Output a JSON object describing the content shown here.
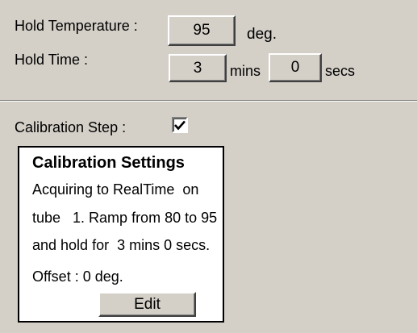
{
  "hold": {
    "temperature_label": "Hold Temperature :",
    "temperature_value": "95",
    "temperature_unit": "deg.",
    "time_label": "Hold Time :",
    "time_mins_value": "3",
    "time_mins_unit": "mins",
    "time_secs_value": "0",
    "time_secs_unit": "secs"
  },
  "calibration": {
    "step_label": "Calibration Step :",
    "step_checked": true,
    "settings": {
      "title": "Calibration Settings",
      "line1": "Acquiring to RealTime  on",
      "line2": "tube   1. Ramp from 80 to 95",
      "line3": "and hold for  3 mins 0 secs.",
      "offset": "Offset : 0 deg.",
      "edit_label": "Edit"
    }
  },
  "colors": {
    "background": "#d4d0c8",
    "panel": "#ffffff"
  },
  "icons": {
    "checkbox": "check-mark-icon"
  }
}
